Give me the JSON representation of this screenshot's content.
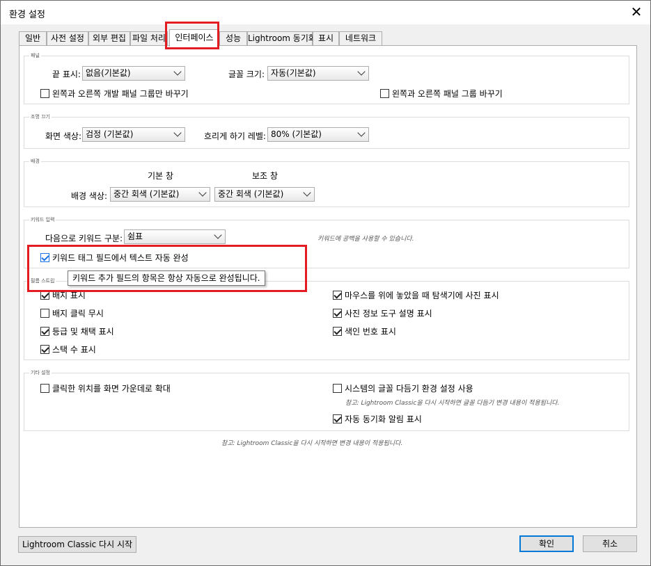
{
  "window": {
    "title": "환경 설정"
  },
  "tabs": [
    {
      "label": "일반"
    },
    {
      "label": "사전 설정"
    },
    {
      "label": "외부 편집"
    },
    {
      "label": "파일 처리"
    },
    {
      "label": "인터페이스"
    },
    {
      "label": "성능"
    },
    {
      "label": "Lightroom 동기화"
    },
    {
      "label": "표시"
    },
    {
      "label": "네트워크"
    }
  ],
  "panel": {
    "title": "패널",
    "end_marks_label": "끝 표시:",
    "end_marks_value": "없음(기본값)",
    "font_size_label": "글꼴 크기:",
    "font_size_value": "자동(기본값)",
    "swap_left_right_open": "왼쪽과 오른쪽 개발 패널 그룹만 바꾸기",
    "swap_left_right_all": "왼쪽과 오른쪽 패널 그룹 바꾸기"
  },
  "lights_out": {
    "title": "조명 끄기",
    "screen_color_label": "화면 색상:",
    "screen_color_value": "검정 (기본값)",
    "dim_level_label": "흐리게 하기 레벨:",
    "dim_level_value": "80% (기본값)"
  },
  "background": {
    "title": "배경",
    "main_window": "기본 창",
    "secondary_window": "보조 창",
    "bg_color_label": "배경 색상:",
    "main_value": "중간 회색 (기본값)",
    "secondary_value": "중간 회색 (기본값)"
  },
  "keyword": {
    "title": "키워드 입력",
    "separate_label": "다음으로 키워드 구분:",
    "separate_value": "쉼표",
    "space_note": "키워드에 공백을 사용할 수 있습니다.",
    "autocomplete_label": "키워드 태그 필드에서 텍스트 자동 완성",
    "tooltip": "키워드 추가 필드의 항목은 항상 자동으로 완성됩니다."
  },
  "filmstrip": {
    "title": "필름 스트립",
    "show_badges": "배지 표시",
    "ignore_badge_clicks": "배지 클릭 무시",
    "show_ratings": "등급 및 채택 표시",
    "show_stack_counts": "스택 수 표시",
    "show_photos_hover": "마우스를 위에 놓았을 때 탐색기에 사진 표시",
    "show_info_tooltips": "사진 정보 도구 설명 표시",
    "show_index_number": "색인 번호 표시"
  },
  "tweaks": {
    "title": "기타 설정",
    "zoom_clicked": "클릭한 위치를 화면 가운데로 확대",
    "system_font": "시스템의 글꼴 다듬기 환경 설정 사용",
    "system_font_note": "참고: Lightroom Classic을 다시 시작하면 글꼴 다듬기 변경 내용이 적용됩니다.",
    "sync_notifications": "자동 동기화 알림 표시"
  },
  "footer_note": "참고: Lightroom Classic을 다시 시작하면 변경 내용이 적용됩니다.",
  "buttons": {
    "restart": "Lightroom Classic 다시 시작",
    "ok": "확인",
    "cancel": "취소"
  },
  "colors": {
    "highlight": "#e31b23",
    "accent": "#0078d7"
  }
}
